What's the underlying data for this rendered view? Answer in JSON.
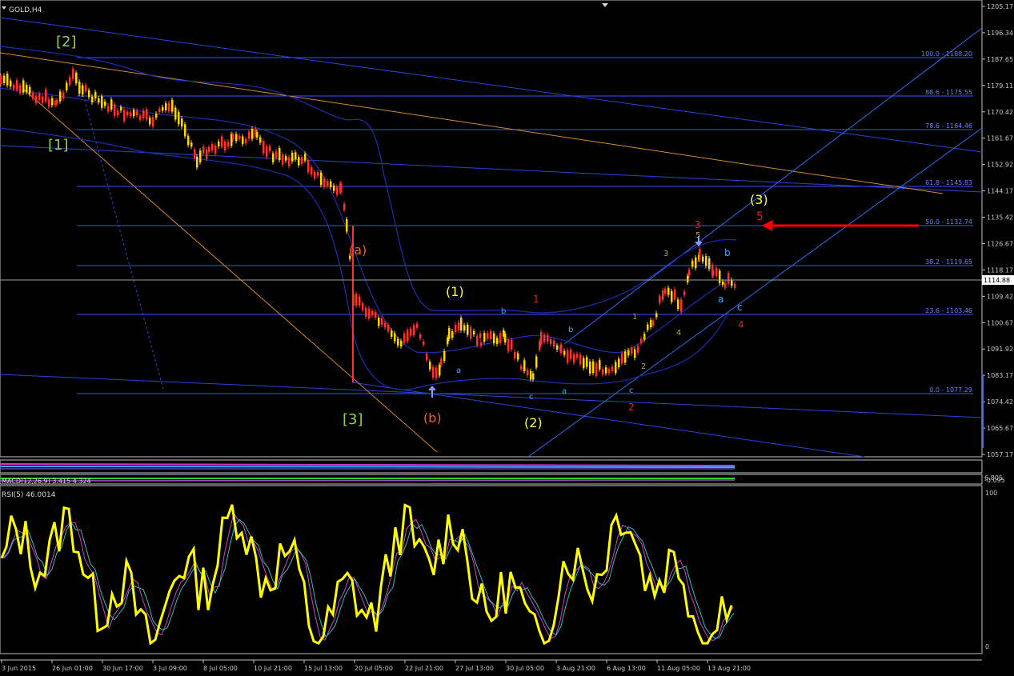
{
  "window": {
    "symbol_label": "GOLD,H4",
    "current_price_label": "1114.88"
  },
  "price_axis": {
    "ticks": [
      "1205.17",
      "1196.34",
      "1187.65",
      "1179.11",
      "1170.42",
      "1161.67",
      "1152.92",
      "1144.17",
      "1135.42",
      "1126.67",
      "1118.17",
      "1109.42",
      "1100.67",
      "1091.92",
      "1083.17",
      "1074.42",
      "1065.67",
      "1057.17"
    ]
  },
  "time_axis": {
    "ticks": [
      "3 Jun 2015",
      "26 Jun 01:00",
      "30 Jun 17:00",
      "3 Jul 09:00",
      "8 Jul 05:00",
      "10 Jul 21:00",
      "15 Jul 13:00",
      "20 Jul 05:00",
      "22 Jul 21:00",
      "27 Jul 13:00",
      "30 Jul 05:00",
      "3 Aug 21:00",
      "6 Aug 13:00",
      "11 Aug 05:00",
      "13 Aug 21:00"
    ]
  },
  "fib_levels": [
    {
      "label": "100.0 - 1188.20"
    },
    {
      "label": "88.6 - 1175.55"
    },
    {
      "label": "78.6 - 1164.46"
    },
    {
      "label": "61.8 - 1145.83"
    },
    {
      "label": "50.0 - 1132.74"
    },
    {
      "label": "38.2 - 1119.65"
    },
    {
      "label": "23.6 - 1103.46"
    },
    {
      "label": "0.0 - 1077.29"
    }
  ],
  "wave_labels": [
    {
      "text": "[2]",
      "color": "#8fd14f"
    },
    {
      "text": "[1]",
      "color": "#8fd14f"
    },
    {
      "text": "[3]",
      "color": "#8fd14f"
    },
    {
      "text": "(a)",
      "color": "#ff5a1f"
    },
    {
      "text": "(b)",
      "color": "#ff5a1f"
    },
    {
      "text": "(1)",
      "color": "#ffff33"
    },
    {
      "text": "(2)",
      "color": "#ffff33"
    },
    {
      "text": "(3)",
      "color": "#ffff33"
    },
    {
      "text": "1",
      "color": "#e02020"
    },
    {
      "text": "2",
      "color": "#e02020"
    },
    {
      "text": "3",
      "color": "#e02020"
    },
    {
      "text": "4",
      "color": "#e02020"
    },
    {
      "text": "5",
      "color": "#e02020"
    },
    {
      "text": "a",
      "color": "#33aaff"
    },
    {
      "text": "b",
      "color": "#33aaff"
    },
    {
      "text": "c",
      "color": "#33aaff"
    },
    {
      "text": "a",
      "color": "#33aaff"
    },
    {
      "text": "b",
      "color": "#33aaff"
    },
    {
      "text": "c",
      "color": "#33aaff"
    },
    {
      "text": "a",
      "color": "#33aaff"
    },
    {
      "text": "b",
      "color": "#33aaff"
    },
    {
      "text": "c",
      "color": "#33aaff"
    },
    {
      "text": "1",
      "color": "#b8a040"
    },
    {
      "text": "2",
      "color": "#b8a040"
    },
    {
      "text": "3",
      "color": "#b8a040"
    },
    {
      "text": "4",
      "color": "#b8a040"
    },
    {
      "text": "5",
      "color": "#b8a040"
    }
  ],
  "macd_panel": {
    "title": "MACD(12,26,9) 3.415 4.324",
    "axis_labels": [
      "6.805",
      "-0.095"
    ]
  },
  "rsi_panel": {
    "title": "RSI(5) 46.0014",
    "axis_top": "100",
    "axis_bottom": "0"
  },
  "colors": {
    "background": "#000000",
    "bull_candle": "#ffd700",
    "bear_candle": "#ff3030",
    "fib_line": "#3a4fff",
    "trend_line": "#2b45d8",
    "orange_line": "#d4892a",
    "rsi_line": "#ffff00",
    "arrow": "#ff0000"
  }
}
